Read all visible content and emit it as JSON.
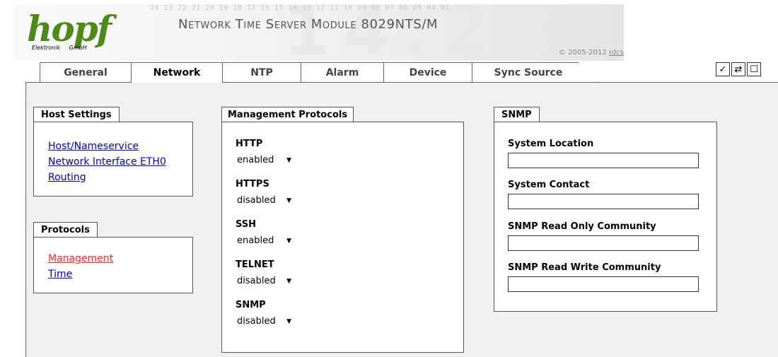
{
  "header": {
    "logo": "hopf",
    "logo_sub": "Elektronik GmbH",
    "tick_numbers": "24 23 22 21 20 19 18 17 16 15 14 13 12 11 10 09 08 07 06 05 04 01",
    "title": "Network Time Server Module 8029NTS/M",
    "copyright_prefix": "© 2005-2012",
    "copyright_link": "rdcs.eu",
    "deco_digits": "14:28"
  },
  "tabs": [
    {
      "label": "General",
      "active": false
    },
    {
      "label": "Network",
      "active": true
    },
    {
      "label": "NTP",
      "active": false
    },
    {
      "label": "Alarm",
      "active": false
    },
    {
      "label": "Device",
      "active": false
    },
    {
      "label": "Sync Source",
      "active": false
    }
  ],
  "toolbar": [
    {
      "icon": "checkmark-icon",
      "glyph": "✓"
    },
    {
      "icon": "swap-arrows-icon",
      "glyph": "⇄"
    },
    {
      "icon": "page-icon",
      "glyph": "☐"
    }
  ],
  "host_settings": {
    "title": "Host Settings",
    "links": [
      "Host/Nameservice",
      "Network Interface ETH0",
      "Routing"
    ]
  },
  "protocols": {
    "title": "Protocols",
    "links": [
      "Management",
      "Time"
    ],
    "active_link": "Management"
  },
  "management_protocols": {
    "title": "Management Protocols",
    "fields": [
      {
        "label": "HTTP",
        "value": "enabled"
      },
      {
        "label": "HTTPS",
        "value": "disabled"
      },
      {
        "label": "SSH",
        "value": "enabled"
      },
      {
        "label": "TELNET",
        "value": "disabled"
      },
      {
        "label": "SNMP",
        "value": "disabled"
      }
    ]
  },
  "snmp": {
    "title": "SNMP",
    "fields": [
      {
        "label": "System Location",
        "value": ""
      },
      {
        "label": "System Contact",
        "value": ""
      },
      {
        "label": "SNMP Read Only Community",
        "value": ""
      },
      {
        "label": "SNMP Read Write Community",
        "value": ""
      }
    ]
  },
  "colors": {
    "logo_green": "#4e8a1a",
    "link_blue": "#0000cc",
    "link_active_red": "#ff2222",
    "content_bg": "#f0f0f0"
  }
}
